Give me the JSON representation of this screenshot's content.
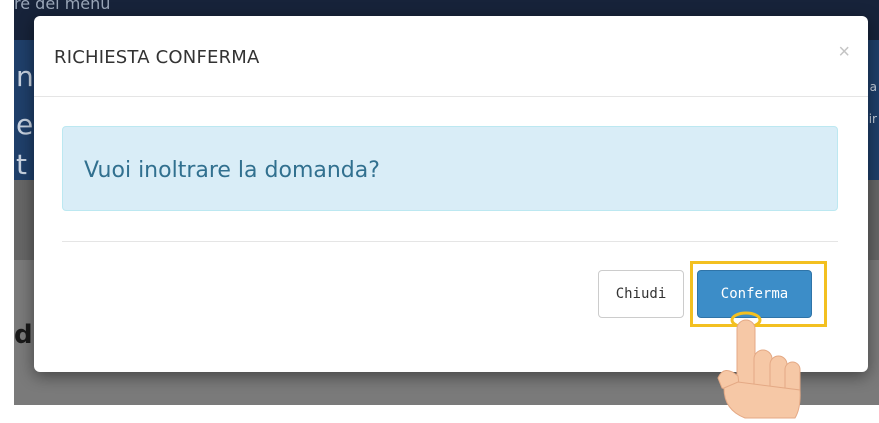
{
  "background": {
    "top_text": "re del menu",
    "left_fragments": [
      "nz",
      "ea",
      "t"
    ],
    "right_fragments": [
      "a",
      "ir"
    ],
    "lower_left_text": "di"
  },
  "modal": {
    "title": "RICHIESTA CONFERMA",
    "close_symbol": "×",
    "message": "Vuoi inoltrare la domanda?",
    "buttons": {
      "close_label": "Chiudi",
      "confirm_label": "Conferma"
    }
  },
  "overlay": {
    "highlight_color": "#f3c020",
    "cursor_icon": "hand-pointer-icon"
  },
  "colors": {
    "alert_bg": "#d9edf7",
    "alert_text": "#31708f",
    "primary_button": "#3c8dc8"
  }
}
